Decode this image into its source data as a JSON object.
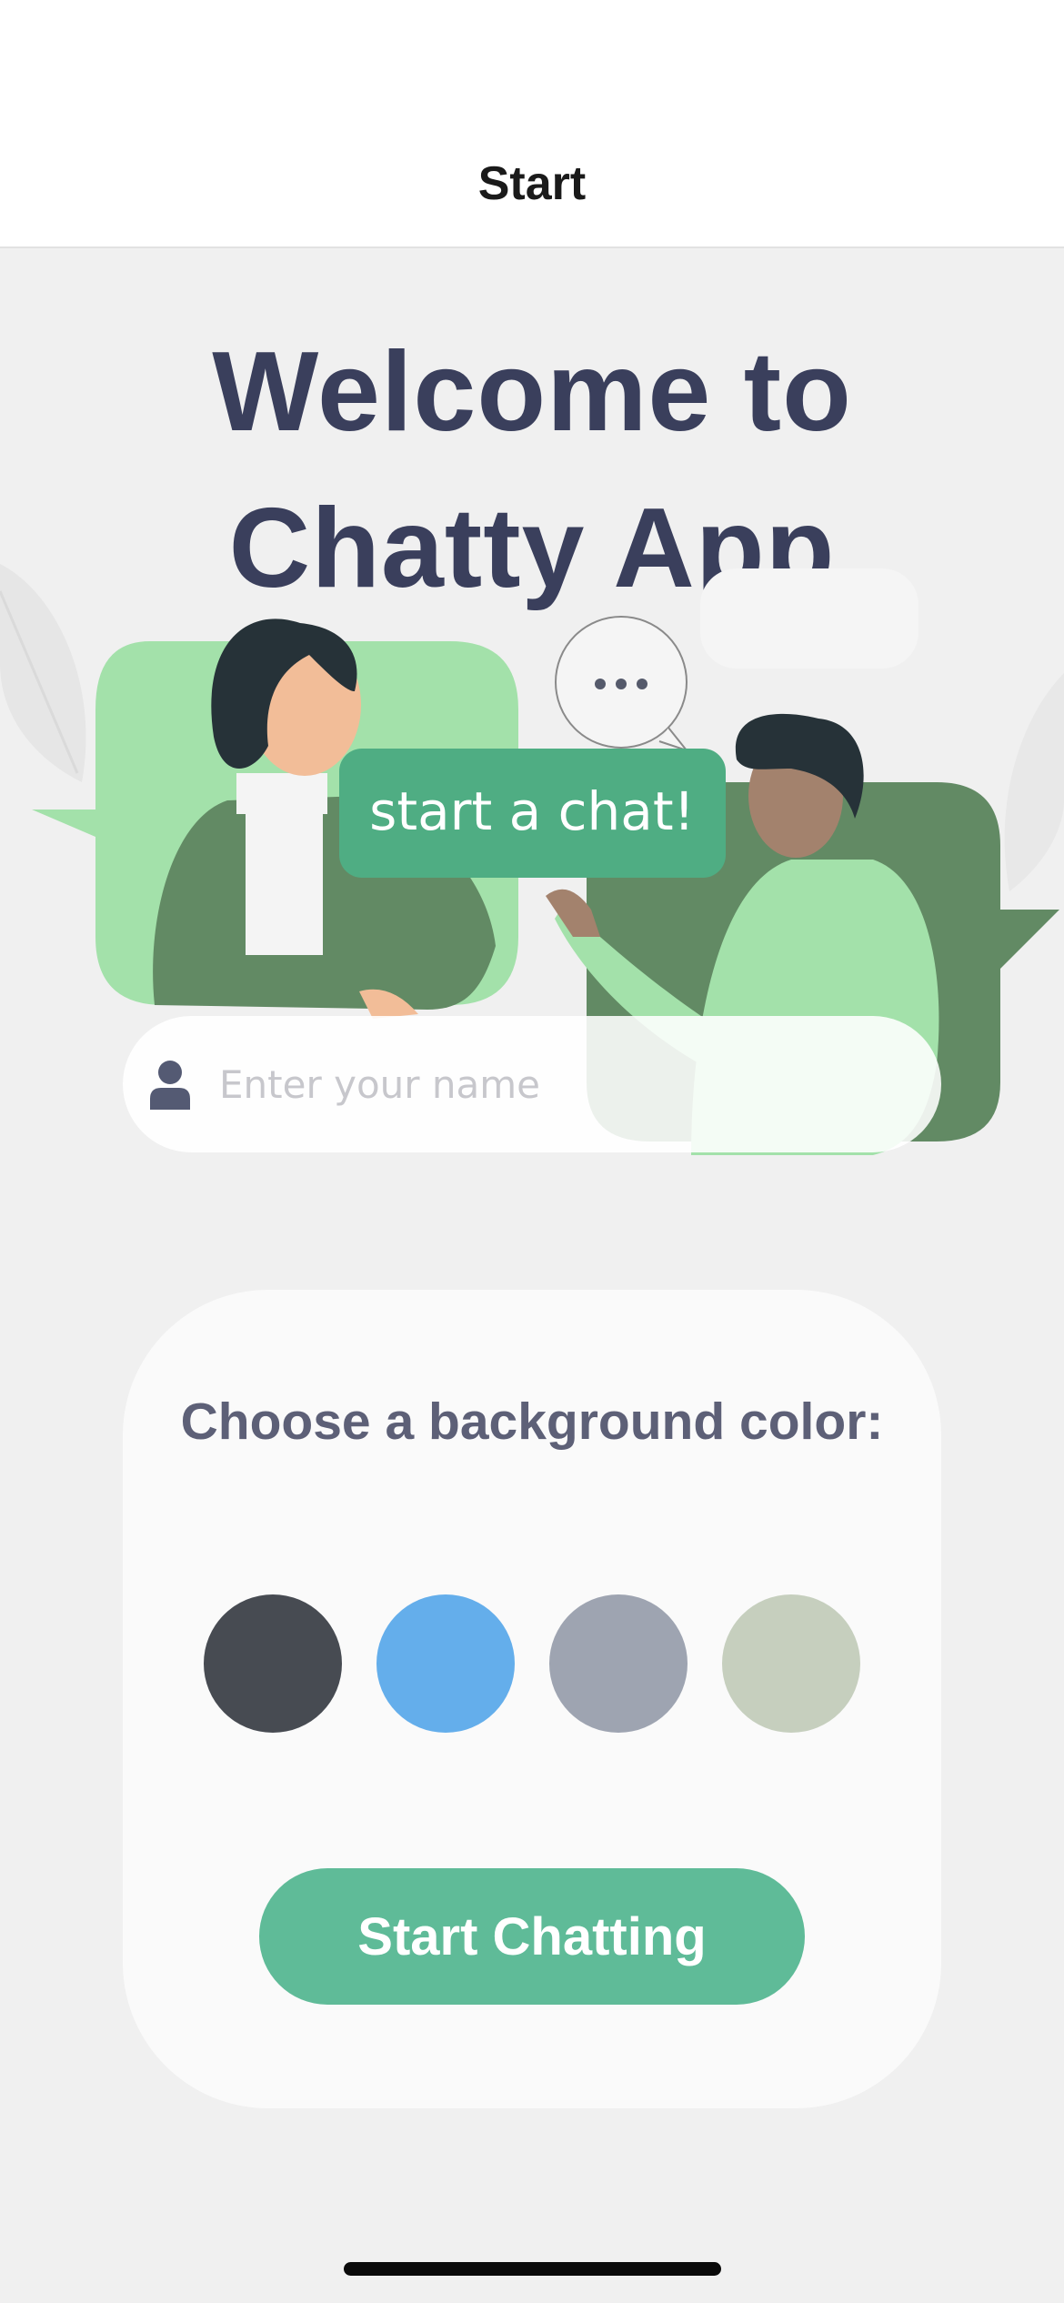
{
  "nav": {
    "title": "Start"
  },
  "welcome": {
    "line1": "Welcome to",
    "line2": "Chatty App"
  },
  "illustration": {
    "bubble_text": "start a chat!",
    "typing_dots": "•••"
  },
  "name_input": {
    "placeholder": "Enter your name",
    "value": "",
    "icon": "person-icon"
  },
  "background_picker": {
    "label": "Choose a background color:",
    "colors": [
      "#474b52",
      "#64aeeb",
      "#9ea4b1",
      "#c6cfbe"
    ]
  },
  "start_button": {
    "label": "Start Chatting"
  }
}
